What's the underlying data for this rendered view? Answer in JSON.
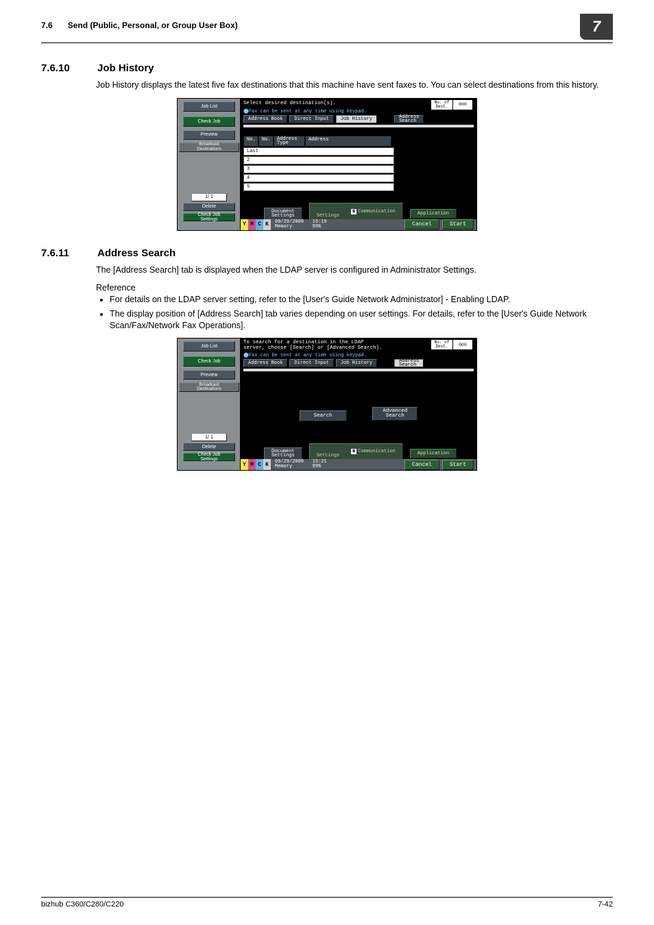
{
  "running_header": {
    "num": "7.6",
    "title": "Send (Public, Personal, or Group User Box)",
    "chapnum": "7"
  },
  "sec1": {
    "num": "7.6.10",
    "title": "Job History",
    "para": "Job History displays the latest five fax destinations that this machine have sent faxes to. You can select destinations from this history."
  },
  "sec2": {
    "num": "7.6.11",
    "title": "Address Search",
    "para": "The [Address Search] tab is displayed when the LDAP server is configured in Administrator Settings.",
    "ref_label": "Reference",
    "b1": "For details on the LDAP server setting, refer to the [User's Guide Network Administrator] - Enabling LDAP.",
    "b2": "The display position of [Address Search] tab varies depending on user settings. For details, refer to the [User's Guide Network Scan/Fax/Network Fax Operations]."
  },
  "panel_common": {
    "left_buttons": {
      "job_list": "Job List",
      "check_job": "Check Job",
      "preview": "Preview",
      "broadcast": "Broadcast\nDestinations",
      "pager": "1/  1",
      "delete": "Delete",
      "check_settings": "Check Job\nSettings"
    },
    "tabs": {
      "ab": "Address Book",
      "di": "Direct Input",
      "jh": "Job History",
      "as": "Address\nSearch"
    },
    "bottom": {
      "doc": "Document\nSettings",
      "comm": "Communication\nSettings",
      "app": "Application"
    },
    "actions": {
      "cancel": "Cancel",
      "start": "Start"
    },
    "dest": {
      "label": "No. of\nDest.",
      "count": "000"
    },
    "toner": {
      "y": "Y",
      "m": "M",
      "c": "C",
      "k": "K"
    }
  },
  "panel1": {
    "headline": "Select desired destination(s).",
    "hint": "⬤Fax can be sent at any time using keypad.",
    "table": {
      "h_no1": "No.",
      "h_no2": "No.",
      "h_type": "Address\nType",
      "h_addr": "Address",
      "rows": [
        "Last",
        "2",
        "3",
        "4",
        "5"
      ]
    },
    "date": "09/29/2009",
    "time": "15:19",
    "mem_label": "Memory",
    "mem_val": "99%"
  },
  "panel2": {
    "headline": "To search for a destination in the LDAP\nserver, choose [Search] or [Advanced Search].",
    "hint": "⬤Fax can be sent at any time using keypad.",
    "search": "Search",
    "adv_search": "Advanced\nSearch",
    "date": "09/29/2009",
    "time": "15:21",
    "mem_label": "Memory",
    "mem_val": "99%"
  },
  "footer": {
    "left": "bizhub C360/C280/C220",
    "right": "7-42"
  }
}
